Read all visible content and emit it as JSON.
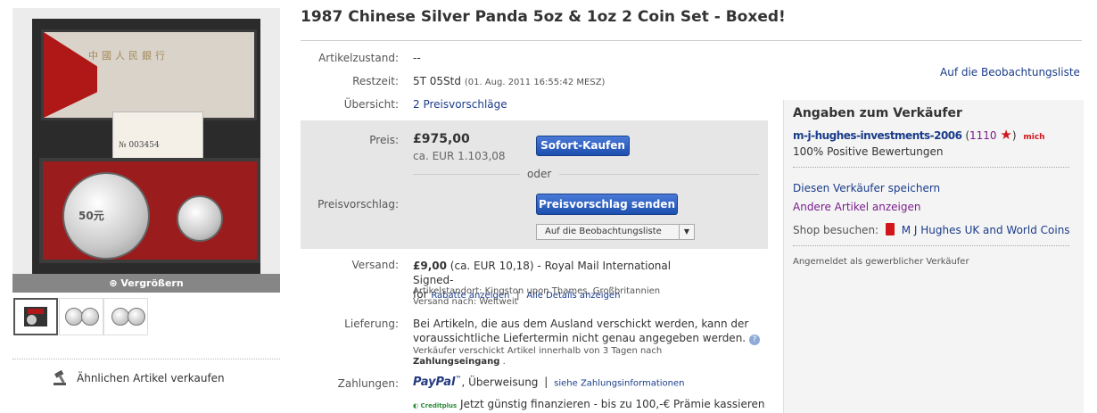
{
  "title": "1987 Chinese Silver Panda 5oz & 1oz 2 Coin Set - Boxed!",
  "gallery": {
    "zoom_label": "Vergrößern",
    "lid_text": "中國人民銀行",
    "card_number": "№ 003454"
  },
  "sell_similar": "Ähnlichen Artikel verkaufen",
  "watch_link": "Auf die Beobachtungsliste",
  "details": {
    "condition_label": "Artikelzustand:",
    "condition_value": "--",
    "remaining_label": "Restzeit:",
    "remaining_value": "5T 05Std",
    "remaining_date": "(01. Aug. 2011 16:55:42 MESZ)",
    "overview_label": "Übersicht:",
    "overview_value": "2 Preisvorschläge"
  },
  "price": {
    "label": "Preis:",
    "amount": "£975,00",
    "converted": "ca. EUR 1.103,08",
    "buy_now": "Sofort-Kaufen",
    "or": "oder",
    "offer_label": "Preisvorschlag:",
    "offer_button": "Preisvorschlag senden",
    "watch_button": "Auf die Beobachtungsliste"
  },
  "shipping": {
    "label": "Versand:",
    "amount": "£9,00",
    "text": "(ca. EUR 10,18) - Royal Mail International Signed-",
    "text2": "for",
    "discounts_link": "Rabatte anzeigen",
    "separator": "|",
    "details_link": "Alle Details anzeigen",
    "location": "Artikelstandort: Kingston upon Thames, Großbritannien",
    "ships_to": "Versand nach: Weltweit"
  },
  "delivery": {
    "label": "Lieferung:",
    "text1": "Bei Artikeln, die aus dem Ausland verschickt werden, kann der",
    "text2": "voraussichtliche Liefertermin nicht genau angegeben werden.",
    "note1": "Verkäufer verschickt Artikel innerhalb von 3 Tagen nach",
    "note2_link": "Zahlungseingang",
    "note2_end": "."
  },
  "payment": {
    "label": "Zahlungen:",
    "paypal": "PayPal",
    "paypal_tm": "™",
    "bank": ", Überweisung",
    "separator": "|",
    "info_link": "siehe Zahlungsinformationen",
    "credit_logo": "Creditplus",
    "finance": "Jetzt günstig finanzieren - bis zu 100,-€ Prämie kassieren"
  },
  "seller": {
    "heading": "Angaben zum Verkäufer",
    "name": "m-j-hughes-investments-2006",
    "paren_open": "(",
    "score": "1110",
    "paren_close": ")",
    "me_badge": "mich",
    "positive": "100% Positive Bewertungen",
    "save_seller": "Diesen Verkäufer speichern",
    "other_items": "Andere Artikel anzeigen",
    "shop_label": "Shop besuchen:",
    "shop_name": "M J Hughes UK and World Coins",
    "business": "Angemeldet als gewerblicher Verkäufer",
    "colors": {
      "star": "#d0161b",
      "other_items": "#7a1e8c",
      "link": "#1a3c8a"
    }
  }
}
